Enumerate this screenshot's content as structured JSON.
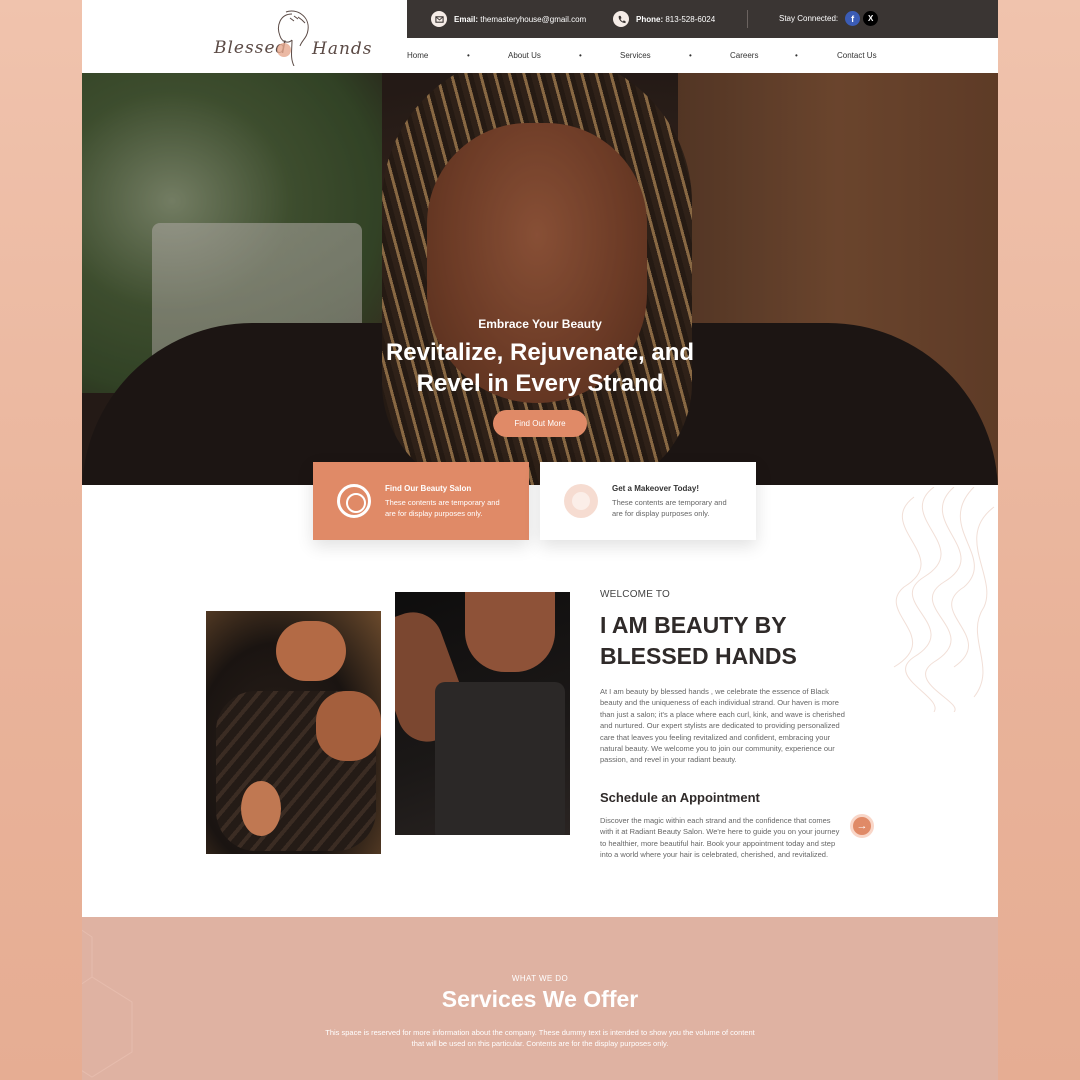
{
  "brand": {
    "logo_word1": "Blessed",
    "logo_word2": "Hands"
  },
  "topbar": {
    "email_label": "Email:",
    "email_value": "themasteryhouse@gmail.com",
    "phone_label": "Phone:",
    "phone_value": "813-528-6024",
    "social_label": "Stay Connected:",
    "facebook_glyph": "f",
    "x_glyph": "X"
  },
  "nav": {
    "items": [
      "Home",
      "About Us",
      "Services",
      "Careers",
      "Contact Us"
    ],
    "separator": "•"
  },
  "hero": {
    "eyebrow": "Embrace Your Beauty",
    "title_line1": "Revitalize, Rejuvenate, and",
    "title_line2": "Revel in Every Strand",
    "button": "Find Out More"
  },
  "cards": [
    {
      "title": "Find Our Beauty Salon",
      "desc": "These contents are  temporary and are for display purposes only."
    },
    {
      "title": "Get a Makeover Today!",
      "desc": "These contents are  temporary and are for display purposes only."
    }
  ],
  "about": {
    "eyebrow": "WELCOME TO",
    "title_line1": "I AM BEAUTY BY",
    "title_line2": "BLESSED HANDS",
    "body": "At I am beauty by blessed hands , we celebrate the essence of Black beauty and the uniqueness of each individual strand. Our haven is more than just a salon; it's a place where each curl, kink, and wave is cherished and nurtured. Our expert stylists are dedicated to providing personalized care that leaves you feeling revitalized and confident, embracing your natural beauty. We welcome you to join our community, experience our passion, and revel in your radiant beauty.",
    "schedule_title": "Schedule an Appointment",
    "schedule_body": "Discover the magic within each strand and the confidence that comes with it at Radiant Beauty Salon. We're here to guide you on your journey to healthier, more beautiful hair. Book your appointment today and step into a world where your hair is celebrated, cherished, and revitalized.",
    "arrow_glyph": "→"
  },
  "services": {
    "eyebrow": "WHAT WE DO",
    "title": "Services We Offer",
    "body": "This space is reserved for more information about the company. These dummy text is intended to show you the volume of content that will be used on this particular. Contents are for the display purposes only."
  },
  "colors": {
    "accent": "#e08a67",
    "dark_bar": "#3a3533",
    "services_bg": "#dfb2a2",
    "page_bg": "#f0c3ad"
  }
}
